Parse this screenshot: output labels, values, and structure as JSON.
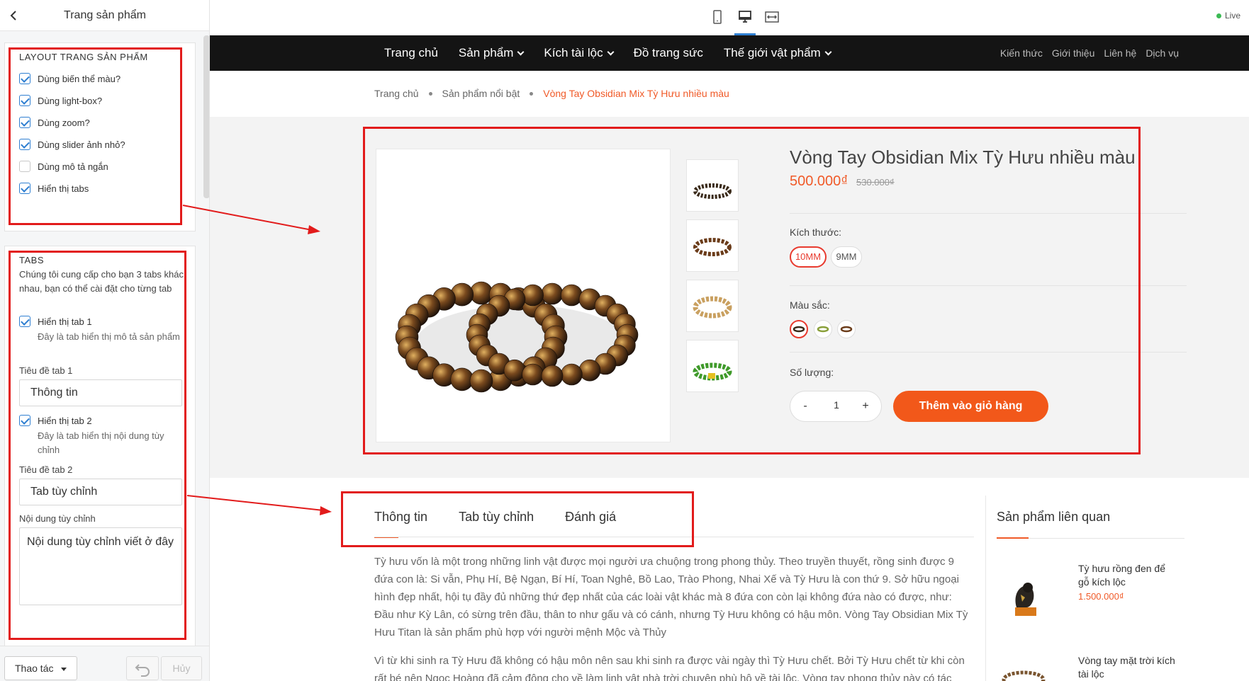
{
  "sidebar": {
    "title": "Trang sản phẩm",
    "layout": {
      "heading": "LAYOUT TRANG SẢN PHẨM",
      "options": [
        {
          "label": "Dùng biến thể màu?",
          "checked": true
        },
        {
          "label": "Dùng light-box?",
          "checked": true
        },
        {
          "label": "Dùng zoom?",
          "checked": true
        },
        {
          "label": "Dùng slider ảnh nhỏ?",
          "checked": true
        },
        {
          "label": "Dùng mô tả ngắn",
          "checked": false
        },
        {
          "label": "Hiển thị tabs",
          "checked": true
        }
      ]
    },
    "tabs": {
      "heading": "TABS",
      "description": "Chúng tôi cung cấp cho bạn 3 tabs khác nhau, bạn có thể cài đặt cho từng tab",
      "tab1_toggle": "Hiển thị tab 1",
      "tab1_hint": "Đây là tab hiển thị mô tả sản phẩm",
      "tab1_title_label": "Tiêu đề tab 1",
      "tab1_title_value": "Thông tin",
      "tab2_toggle": "Hiển thị tab 2",
      "tab2_hint": "Đây là tab hiển thị nội dung tùy chỉnh",
      "tab2_title_label": "Tiêu đề tab 2",
      "tab2_title_value": "Tab tùy chỉnh",
      "custom_label": "Nội dung tùy chỉnh",
      "custom_value": "Nội dung tùy chỉnh viết ở đây"
    },
    "footer": {
      "actions_label": "Thao tác",
      "cancel_label": "Hủy"
    }
  },
  "topbar": {
    "live_label": "Live",
    "accent": "#2f7fd1"
  },
  "site": {
    "nav_main": [
      {
        "label": "Trang chủ",
        "dropdown": false
      },
      {
        "label": "Sản phẩm",
        "dropdown": true
      },
      {
        "label": "Kích tài lộc",
        "dropdown": true
      },
      {
        "label": "Đồ trang sức",
        "dropdown": false
      },
      {
        "label": "Thế giới vật phẩm",
        "dropdown": true
      }
    ],
    "nav_sub": [
      "Kiến thức",
      "Giới thiệu",
      "Liên hệ",
      "Dịch vụ"
    ],
    "breadcrumb": [
      "Trang chủ",
      "Sản phẩm nổi bật",
      "Vòng Tay Obsidian Mix Tỳ Hưu nhiều màu"
    ],
    "product": {
      "title": "Vòng Tay Obsidian Mix Tỳ Hưu nhiều màu",
      "price": "500.000₫",
      "old_price": "530.000₫",
      "size_label": "Kích thước:",
      "sizes": [
        "10MM",
        "9MM"
      ],
      "color_label": "Màu sắc:",
      "qty_label": "Số lượng:",
      "qty_minus": "-",
      "qty_value": "1",
      "qty_plus": "+",
      "add_to_cart": "Thêm vào giỏ hàng",
      "accent": "#f2581a"
    },
    "tabs": [
      "Thông tin",
      "Tab tùy chỉnh",
      "Đánh giá"
    ],
    "content": [
      "Tỳ hưu vốn là một trong những linh vật được mọi người ưa chuộng trong phong thủy. Theo truyền thuyết, rồng sinh được 9 đứa con là: Si vẫn, Phụ Hí, Bệ Ngạn, Bí Hí, Toan Nghê, Bồ Lao, Trào Phong, Nhai Xế và Tỳ Hưu là con thứ 9. Sở hữu ngoại hình đẹp nhất, hội tụ đầy đủ những thứ đẹp nhất của các loài vật khác mà 8 đứa con còn lại không đứa nào có được, như: Đầu như Kỳ Lân, có sừng trên đầu, thân to như gấu và có cánh, nhưng Tỳ Hưu không có hậu môn. Vòng Tay Obsidian Mix Tỳ Hưu Titan là sản phẩm phù hợp với người mệnh Mộc và Thủy",
      "Vì từ khi sinh ra Tỳ Hưu đã không có hậu môn nên sau khi sinh ra được vài ngày thì Tỳ Hưu chết. Bởi Tỳ Hưu chết từ khi còn rất bé nên Ngọc Hoàng đã cảm động cho về làm linh vật nhà trời chuyên phù hộ về tài lộc. Vòng tay phong thủy này có tác"
    ],
    "related": {
      "title": "Sản phẩm liên quan",
      "items": [
        {
          "name": "Tỳ hưu rồng đen để gỗ kích lộc",
          "price": "1.500.000₫"
        },
        {
          "name": "Vòng tay mặt trời kích tài lộc",
          "price": ""
        }
      ]
    }
  },
  "annotation_color": "#e21b1b"
}
